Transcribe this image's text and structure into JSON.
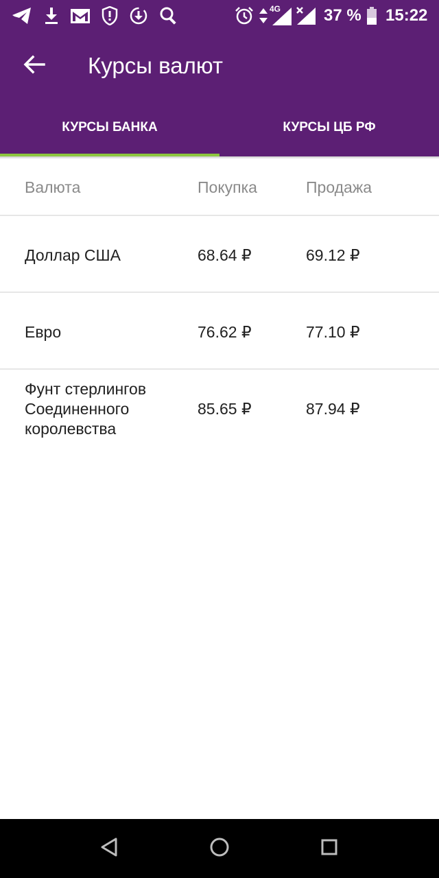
{
  "status_bar": {
    "battery_percent": "37 %",
    "time": "15:22",
    "network_type": "4G",
    "icons": [
      "telegram-icon",
      "download-icon",
      "gmail-icon",
      "shield-icon",
      "download-circle-icon",
      "search-icon",
      "alarm-icon",
      "data-arrows-icon",
      "signal-icon",
      "signal-x-icon",
      "battery-icon"
    ]
  },
  "app_bar": {
    "title": "Курсы валют",
    "back_icon": "arrow-back-icon"
  },
  "tabs": [
    {
      "label": "КУРСЫ БАНКА",
      "selected": true
    },
    {
      "label": "КУРСЫ ЦБ РФ",
      "selected": false
    }
  ],
  "table": {
    "headers": {
      "currency": "Валюта",
      "buy": "Покупка",
      "sell": "Продажа"
    },
    "rows": [
      {
        "currency": "Доллар США",
        "buy": "68.64 ₽",
        "sell": "69.12 ₽"
      },
      {
        "currency": "Евро",
        "buy": "76.62 ₽",
        "sell": "77.10 ₽"
      },
      {
        "currency": "Фунт стерлингов Соединенного королевства",
        "buy": "85.65 ₽",
        "sell": "87.94 ₽"
      }
    ]
  },
  "colors": {
    "brand_purple": "#5c1f74",
    "tab_indicator": "#8dc63f"
  },
  "nav_bar": {
    "icons": [
      "back-triangle-icon",
      "home-circle-icon",
      "recents-square-icon"
    ]
  }
}
